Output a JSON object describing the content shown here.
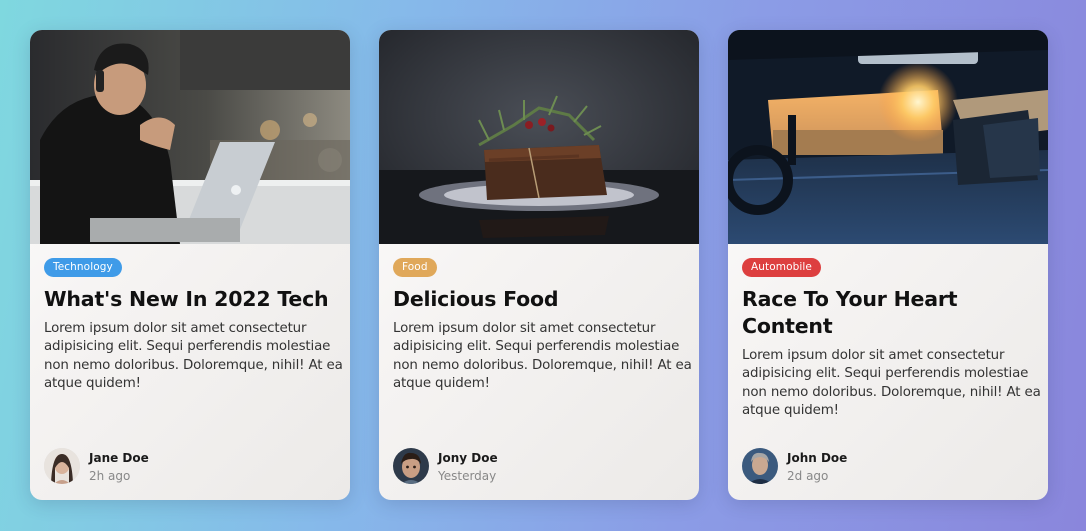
{
  "cards": [
    {
      "image_subject": "man-with-laptop",
      "tag": {
        "label": "Technology",
        "color": "#3f9be8"
      },
      "title": "What's New In 2022 Tech",
      "description": "Lorem ipsum dolor sit amet consectetur adipisicing elit. Sequi perferendis molestiae non nemo doloribus. Doloremque, nihil! At ea atque quidem!",
      "author": {
        "name": "Jane Doe",
        "time": "2h ago"
      }
    },
    {
      "image_subject": "chocolate-cake",
      "tag": {
        "label": "Food",
        "color": "#e0a85a"
      },
      "title": "Delicious Food",
      "description": "Lorem ipsum dolor sit amet consectetur adipisicing elit. Sequi perferendis molestiae non nemo doloribus. Doloremque, nihil! At ea atque quidem!",
      "author": {
        "name": "Jony Doe",
        "time": "Yesterday"
      }
    },
    {
      "image_subject": "car-interior-sunset",
      "tag": {
        "label": "Automobile",
        "color": "#dd3f3f"
      },
      "title": "Race To Your Heart Content",
      "description": "Lorem ipsum dolor sit amet consectetur adipisicing elit. Sequi perferendis molestiae non nemo doloribus. Doloremque, nihil! At ea atque quidem!",
      "author": {
        "name": "John Doe",
        "time": "2d ago"
      }
    }
  ]
}
